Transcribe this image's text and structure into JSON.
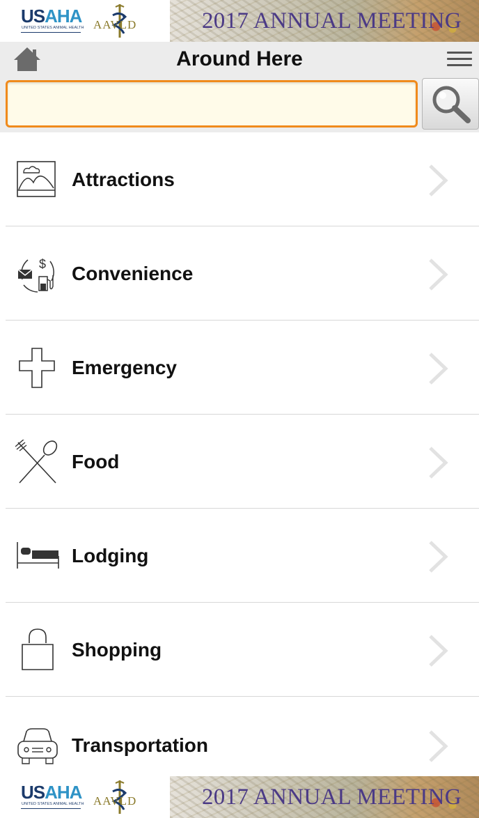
{
  "banner": {
    "usaha_logo_text": "USAHA",
    "usaha_tagline": "UNITED STATES ANIMAL HEALTH",
    "aavld_logo_text": "AAVLD",
    "meeting_title": "2017 ANNUAL MEETING"
  },
  "header": {
    "title": "Around Here",
    "home_icon": "home-icon",
    "menu_icon": "hamburger-menu-icon"
  },
  "search": {
    "value": "",
    "placeholder": "",
    "button_icon": "search-icon"
  },
  "categories": [
    {
      "label": "Attractions",
      "icon": "landscape-icon"
    },
    {
      "label": "Convenience",
      "icon": "convenience-icon"
    },
    {
      "label": "Emergency",
      "icon": "medical-cross-icon"
    },
    {
      "label": "Food",
      "icon": "fork-spoon-icon"
    },
    {
      "label": "Lodging",
      "icon": "bed-icon"
    },
    {
      "label": "Shopping",
      "icon": "shopping-bag-icon"
    },
    {
      "label": "Transportation",
      "icon": "car-icon"
    }
  ],
  "colors": {
    "search_border": "#f08a1c",
    "header_background": "#ececec",
    "meeting_title_color": "#4b3a86",
    "usaha_navy": "#1b3a6b",
    "usaha_blue": "#2f93c6"
  }
}
